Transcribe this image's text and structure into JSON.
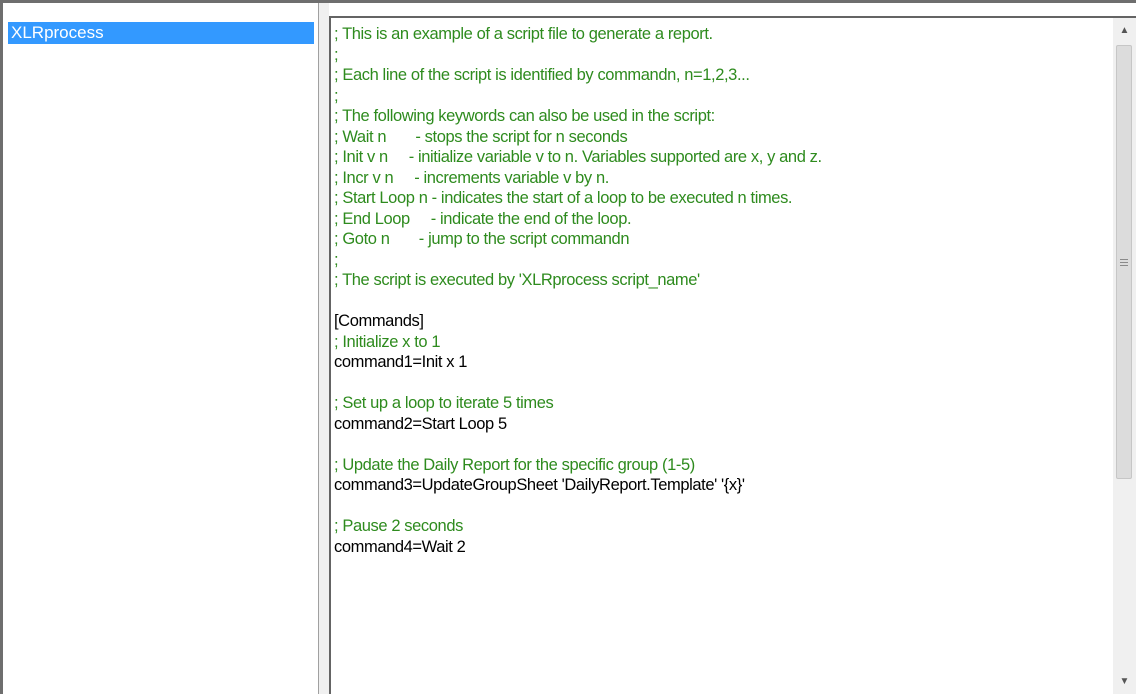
{
  "list": {
    "items": [
      "XLRprocess"
    ]
  },
  "editor": {
    "lines": [
      {
        "type": "comment",
        "text": "; This is an example of a script file to generate a report."
      },
      {
        "type": "comment",
        "text": ";"
      },
      {
        "type": "comment",
        "text": "; Each line of the script is identified by commandn, n=1,2,3..."
      },
      {
        "type": "comment",
        "text": ";"
      },
      {
        "type": "comment",
        "text": "; The following keywords can also be used in the script:"
      },
      {
        "type": "comment",
        "text": "; Wait n       - stops the script for n seconds"
      },
      {
        "type": "comment",
        "text": "; Init v n     - initialize variable v to n. Variables supported are x, y and z."
      },
      {
        "type": "comment",
        "text": "; Incr v n     - increments variable v by n."
      },
      {
        "type": "comment",
        "text": "; Start Loop n - indicates the start of a loop to be executed n times."
      },
      {
        "type": "comment",
        "text": "; End Loop     - indicate the end of the loop."
      },
      {
        "type": "comment",
        "text": "; Goto n       - jump to the script commandn"
      },
      {
        "type": "comment",
        "text": ";"
      },
      {
        "type": "comment",
        "text": "; The script is executed by 'XLRprocess script_name'"
      },
      {
        "type": "blank",
        "text": ""
      },
      {
        "type": "code",
        "text": "[Commands]"
      },
      {
        "type": "comment",
        "text": "; Initialize x to 1"
      },
      {
        "type": "code",
        "text": "command1=Init x 1"
      },
      {
        "type": "blank",
        "text": ""
      },
      {
        "type": "comment",
        "text": "; Set up a loop to iterate 5 times"
      },
      {
        "type": "code",
        "text": "command2=Start Loop 5"
      },
      {
        "type": "blank",
        "text": ""
      },
      {
        "type": "comment",
        "text": "; Update the Daily Report for the specific group (1-5)"
      },
      {
        "type": "code",
        "text": "command3=UpdateGroupSheet 'DailyReport.Template' '{x}'"
      },
      {
        "type": "blank",
        "text": ""
      },
      {
        "type": "comment",
        "text": "; Pause 2 seconds"
      },
      {
        "type": "code",
        "text": "command4=Wait 2"
      }
    ]
  },
  "scrollbar": {
    "up_icon": "scroll-up-arrow",
    "down_icon": "scroll-down-arrow",
    "position_fraction": 0
  },
  "colors": {
    "selection": "#3399ff",
    "comment": "#2e8b1e",
    "code": "#000000"
  }
}
